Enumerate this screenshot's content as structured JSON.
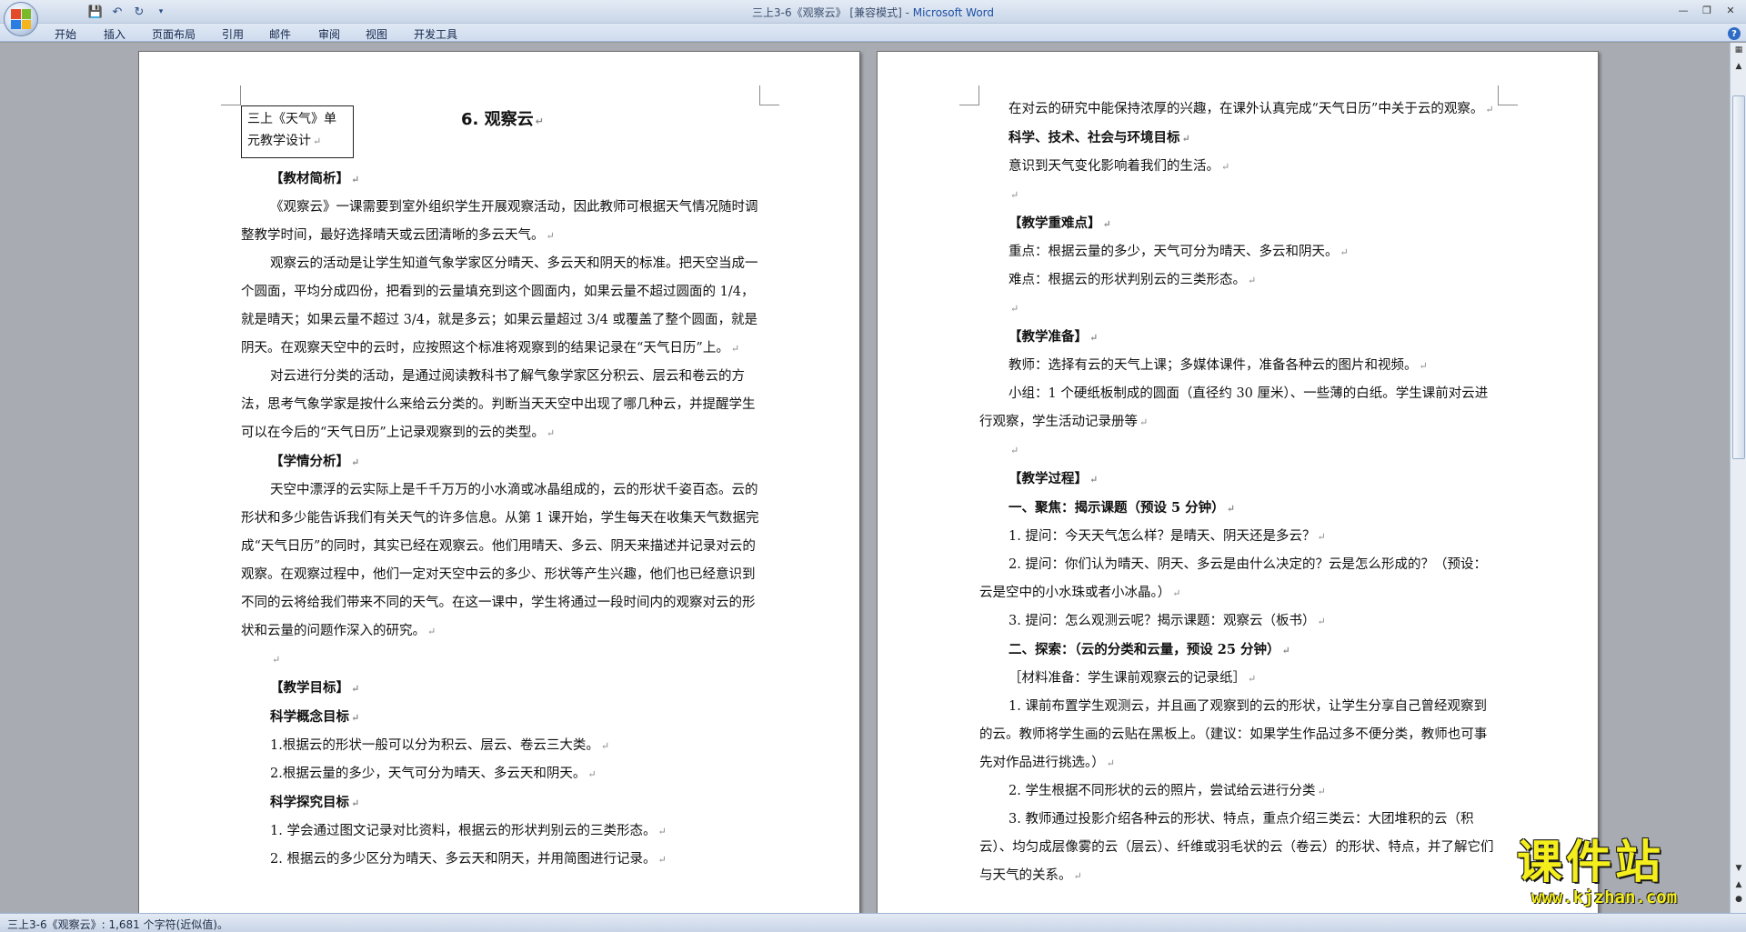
{
  "window": {
    "title_doc": "三上3-6《观察云》 [兼容模式] -",
    "title_app": " Microsoft Word"
  },
  "ribbon": {
    "tabs": [
      "开始",
      "插入",
      "页面布局",
      "引用",
      "邮件",
      "审阅",
      "视图",
      "开发工具"
    ]
  },
  "status": {
    "text": "三上3-6《观察云》: 1,681 个字符(近似值)。"
  },
  "watermark": {
    "main": "课件站",
    "url": "www.kjzhan.com"
  },
  "left_page": {
    "title_box": [
      "三上《天气》单",
      "元教学设计"
    ],
    "lesson_title": "6. 观察云",
    "paragraphs": [
      {
        "text": "【教材简析】",
        "bold": true
      },
      {
        "text": "《观察云》一课需要到室外组织学生开展观察活动，因此教师可根据天气情况随时调整教学时间，最好选择晴天或云团清晰的多云天气。"
      },
      {
        "text": "观察云的活动是让学生知道气象学家区分晴天、多云天和阴天的标准。把天空当成一个圆面，平均分成四份，把看到的云量填充到这个圆面内，如果云量不超过圆面的 1/4，就是晴天；如果云量不超过 3/4，就是多云；如果云量超过 3/4 或覆盖了整个圆面，就是阴天。在观察天空中的云时，应按照这个标准将观察到的结果记录在“天气日历”上。"
      },
      {
        "text": "对云进行分类的活动，是通过阅读教科书了解气象学家区分积云、层云和卷云的方法，思考气象学家是按什么来给云分类的。判断当天天空中出现了哪几种云，并提醒学生可以在今后的“天气日历”上记录观察到的云的类型。"
      },
      {
        "text": "【学情分析】",
        "bold": true
      },
      {
        "text": "天空中漂浮的云实际上是千千万万的小水滴或冰晶组成的，云的形状千姿百态。云的形状和多少能告诉我们有关天气的许多信息。从第 1 课开始，学生每天在收集天气数据完成“天气日历”的同时，其实已经在观察云。他们用晴天、多云、阴天来描述并记录对云的观察。在观察过程中，他们一定对天空中云的多少、形状等产生兴趣，他们也已经意识到不同的云将给我们带来不同的天气。在这一课中，学生将通过一段时间内的观察对云的形状和云量的问题作深入的研究。"
      },
      {
        "text": "",
        "empty": true
      },
      {
        "text": "【教学目标】",
        "bold": true
      },
      {
        "text": "科学概念目标",
        "bold": true
      },
      {
        "text": "1.根据云的形状一般可以分为积云、层云、卷云三大类。"
      },
      {
        "text": "2.根据云量的多少，天气可分为晴天、多云天和阴天。"
      },
      {
        "text": "科学探究目标",
        "bold": true
      },
      {
        "text": "1. 学会通过图文记录对比资料，根据云的形状判别云的三类形态。"
      },
      {
        "text": "2. 根据云的多少区分为晴天、多云天和阴天，并用简图进行记录。"
      }
    ]
  },
  "right_page": {
    "paragraphs": [
      {
        "text": "在对云的研究中能保持浓厚的兴趣，在课外认真完成“天气日历”中关于云的观察。"
      },
      {
        "text": "科学、技术、社会与环境目标",
        "bold": true
      },
      {
        "text": "意识到天气变化影响着我们的生活。"
      },
      {
        "text": "",
        "empty": true
      },
      {
        "text": "【教学重难点】",
        "bold": true
      },
      {
        "text": "重点：根据云量的多少，天气可分为晴天、多云和阴天。"
      },
      {
        "text": "难点：根据云的形状判别云的三类形态。"
      },
      {
        "text": "",
        "empty": true
      },
      {
        "text": "【教学准备】",
        "bold": true
      },
      {
        "text": "教师：选择有云的天气上课；多媒体课件，准备各种云的图片和视频。"
      },
      {
        "text": "小组：1 个硬纸板制成的圆面（直径约 30 厘米）、一些薄的白纸。学生课前对云进行观察，学生活动记录册等"
      },
      {
        "text": "",
        "empty": true
      },
      {
        "text": "【教学过程】",
        "bold": true
      },
      {
        "text": "一、聚焦：揭示课题（预设 5 分钟）",
        "bold": true
      },
      {
        "text": "1. 提问：今天天气怎么样？是晴天、阴天还是多云？"
      },
      {
        "text": "2. 提问：你们认为晴天、阴天、多云是由什么决定的？云是怎么形成的？（预设：云是空中的小水珠或者小冰晶。）"
      },
      {
        "text": "3. 提问：怎么观测云呢？揭示课题：观察云（板书）"
      },
      {
        "text": "二、探索：（云的分类和云量，预设 25 分钟）",
        "bold": true
      },
      {
        "text": "［材料准备：学生课前观察云的记录纸］"
      },
      {
        "text": "1. 课前布置学生观测云，并且画了观察到的云的形状，让学生分享自己曾经观察到的云。教师将学生画的云贴在黑板上。（建议：如果学生作品过多不便分类，教师也可事先对作品进行挑选。）"
      },
      {
        "text": "2. 学生根据不同形状的云的照片，尝试给云进行分类"
      },
      {
        "text": "3. 教师通过投影介绍各种云的形状、特点，重点介绍三类云：大团堆积的云（积云）、均匀成层像雾的云（层云）、纤维或羽毛状的云（卷云）的形状、特点，并了解它们与天气的关系。"
      }
    ]
  }
}
